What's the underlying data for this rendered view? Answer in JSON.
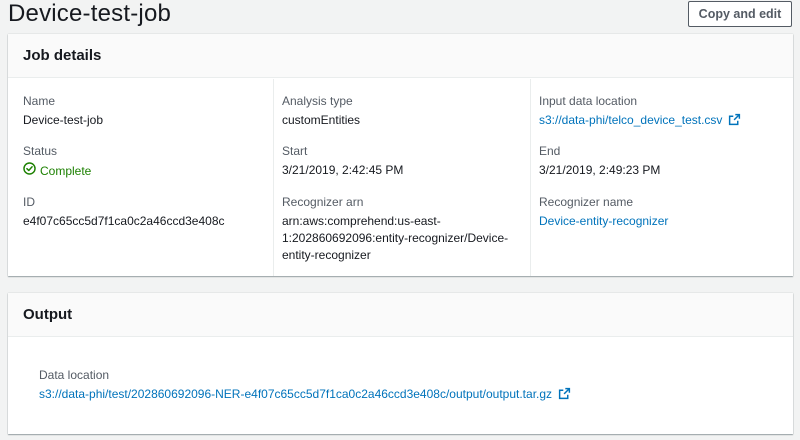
{
  "header": {
    "title": "Device-test-job",
    "copy_edit_label": "Copy and edit"
  },
  "job_details": {
    "title": "Job details",
    "name": {
      "label": "Name",
      "value": "Device-test-job"
    },
    "status": {
      "label": "Status",
      "value": "Complete",
      "icon": "check-circle-icon",
      "color": "#1d8102"
    },
    "id": {
      "label": "ID",
      "value": "e4f07c65cc5d7f1ca0c2a46ccd3e408c"
    },
    "analysis_type": {
      "label": "Analysis type",
      "value": "customEntities"
    },
    "start": {
      "label": "Start",
      "value": "3/21/2019, 2:42:45 PM"
    },
    "recognizer_arn": {
      "label": "Recognizer arn",
      "value_line1": "arn:aws:comprehend:us-east-",
      "value_line2": "1:202860692096:entity-recognizer/Device-",
      "value_line3": "entity-recognizer"
    },
    "input_location": {
      "label": "Input data location",
      "value": "s3://data-phi/telco_device_test.csv",
      "icon": "external-link-icon"
    },
    "end": {
      "label": "End",
      "value": "3/21/2019, 2:49:23 PM"
    },
    "recognizer_name": {
      "label": "Recognizer name",
      "value": "Device-entity-recognizer"
    }
  },
  "output": {
    "title": "Output",
    "data_location": {
      "label": "Data location",
      "value": "s3://data-phi/test/202860692096-NER-e4f07c65cc5d7f1ca0c2a46ccd3e408c/output/output.tar.gz",
      "icon": "external-link-icon"
    }
  },
  "colors": {
    "link": "#0073bb",
    "success": "#1d8102",
    "label": "#545b64",
    "background": "#f2f3f3"
  }
}
